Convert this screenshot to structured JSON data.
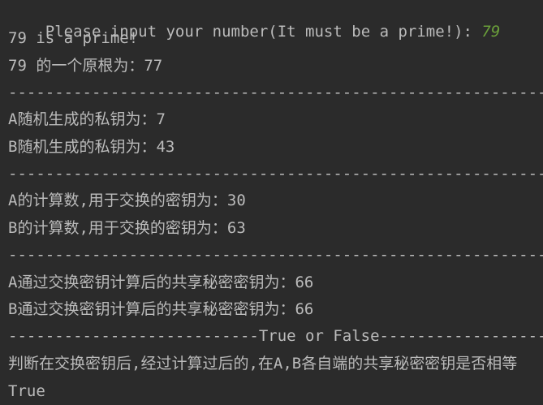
{
  "console": {
    "prompt": "Please input your number(It must be a prime!): ",
    "input_value": "79",
    "line_prime": "79 is a prime!",
    "line_root": "79 的一个原根为：77",
    "separator_1": "--------------------------------------------------------------------------------------------------------------------------------------------",
    "private_key_a": "A随机生成的私钥为：7",
    "private_key_b": "B随机生成的私钥为：43",
    "separator_2": "--------------------------------------------------------------------------------------------------------------------------------------------",
    "exchange_key_a": "A的计算数,用于交换的密钥为：30",
    "exchange_key_b": "B的计算数,用于交换的密钥为：63",
    "separator_3": "--------------------------------------------------------------------------------------------------------------------------------------------",
    "shared_key_a": "A通过交换密钥计算后的共享秘密密钥为：66",
    "shared_key_b": "B通过交换密钥计算后的共享秘密密钥为：66",
    "separator_4": "---------------------------True or False---------------------------------------------------------------------------------------",
    "judge_text": "判断在交换密钥后,经过计算过后的,在A,B各自端的共享秘密密钥是否相等",
    "result": "True"
  },
  "colors": {
    "background": "#2b2b2b",
    "text": "#bbbbbb",
    "input": "#6a9f3a"
  }
}
